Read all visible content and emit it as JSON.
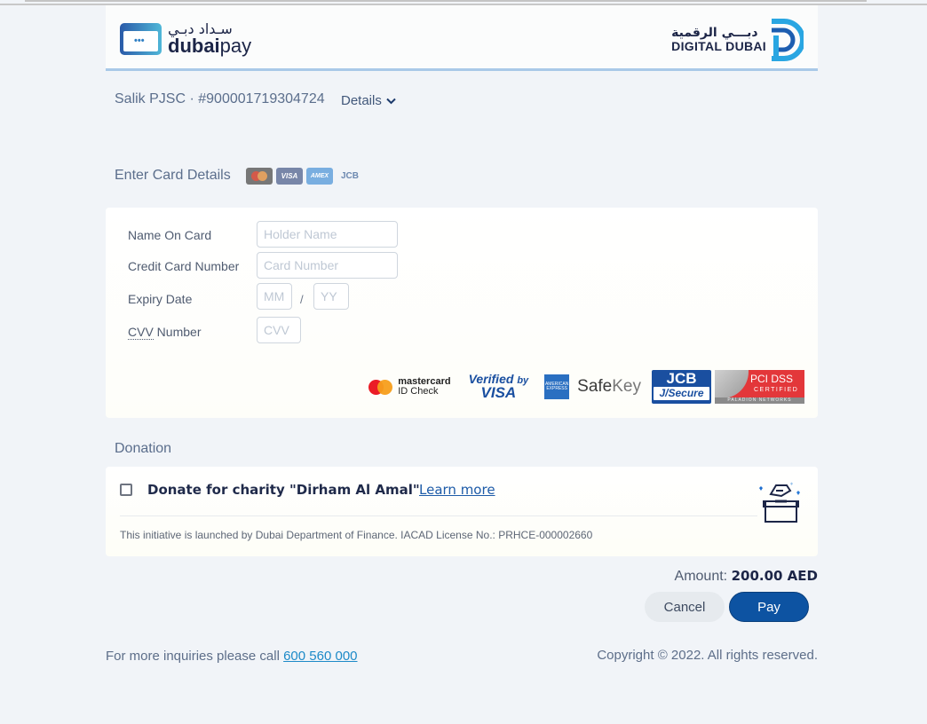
{
  "header": {
    "left_logo": {
      "arabic": "سـداد دبـي",
      "brand_bold": "dubai",
      "brand_light": "pay"
    },
    "right_logo": {
      "arabic": "دبـــي الرقمية",
      "english": "DIGITAL DUBAI"
    }
  },
  "merchant": {
    "label": "Salik PJSC · #900001719304724",
    "details_label": "Details"
  },
  "card_section": {
    "title": "Enter Card Details",
    "accepted_cards": [
      "mastercard",
      "VISA",
      "AMEX",
      "JCB"
    ],
    "fields": [
      {
        "label": "Name On Card",
        "placeholder": "Holder Name",
        "value": ""
      },
      {
        "label": "Credit Card Number",
        "placeholder": "Card Number",
        "value": ""
      },
      {
        "label": "Expiry Date",
        "month_placeholder": "MM",
        "year_placeholder": "YY",
        "separator": "/"
      },
      {
        "label_abbr": "CVV",
        "label_rest": " Number",
        "placeholder": "CVV",
        "value": ""
      }
    ],
    "security_badges": {
      "mastercard": {
        "line1": "mastercard",
        "line2": "ID Check"
      },
      "visa": {
        "line1": "Verified",
        "line1_small": "by",
        "line2": "VISA"
      },
      "amex": {
        "box_text": "AMERICAN EXPRESS",
        "safekey_a": "Safe",
        "safekey_b": "Key"
      },
      "jcb": {
        "line1": "JCB",
        "line2": "J/Secure"
      },
      "pci": {
        "line1": "PCI DSS",
        "line2": "CERTIFIED",
        "line3": "PALADION NETWORKS"
      }
    }
  },
  "donation": {
    "title": "Donation",
    "checkbox_checked": false,
    "text": "Donate for charity \"Dirham Al Amal\"",
    "learn_more": "Learn more",
    "note": "This initiative is launched by Dubai Department of Finance. IACAD License No.: PRHCE-000002660"
  },
  "summary": {
    "amount_label": "Amount:",
    "amount_value": "200.00 AED"
  },
  "actions": {
    "cancel": "Cancel",
    "pay": "Pay"
  },
  "footer": {
    "inquiry_text": "For more inquiries please call",
    "phone": "600 560 000",
    "copyright": "Copyright © 2022. All rights reserved."
  },
  "colors": {
    "primary": "#0d53a2",
    "link": "#1d8ac8",
    "background": "#f1f4f8"
  }
}
